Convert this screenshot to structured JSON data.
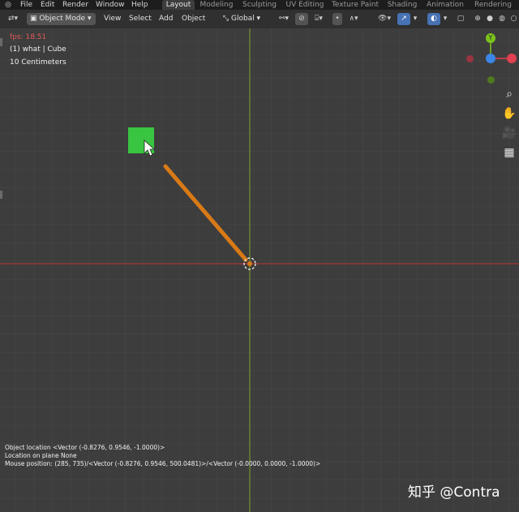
{
  "topbar": {
    "menus": [
      "File",
      "Edit",
      "Render",
      "Window",
      "Help"
    ],
    "workspaces": [
      "Layout",
      "Modeling",
      "Sculpting",
      "UV Editing",
      "Texture Paint",
      "Shading",
      "Animation",
      "Rendering"
    ],
    "active_workspace": "Layout"
  },
  "header": {
    "mode": "Object Mode",
    "view_menu": "View",
    "select_menu": "Select",
    "add_menu": "Add",
    "object_menu": "Object",
    "orientation": "Global"
  },
  "overlay": {
    "fps": "fps: 18.51",
    "object_info": "(1) what | Cube",
    "grid_scale": "10 Centimeters"
  },
  "gizmo": {
    "axis_y_label": "Y",
    "colors": {
      "x": "#e0404f",
      "y": "#7cc31c",
      "z": "#3b86e6"
    }
  },
  "info": {
    "line1": "Object location <Vector (-0.8276, 0.9546, -1.0000)>",
    "line2": "Location on plane None",
    "line3": "Mouse position: (285, 735)/<Vector (-0.8276, 0.9546, 500.0481)>/<Vector (-0.0000, 0.0000, -1.0000)>"
  },
  "watermark": "知乎 @Contra",
  "colors": {
    "viewport_bg": "#3d3d3d",
    "grid_line": "#4a4a4a",
    "x_axis": "#d93a3a",
    "y_axis": "#8bb92d",
    "cube": "#39c441",
    "stroke": "#d97a16"
  }
}
